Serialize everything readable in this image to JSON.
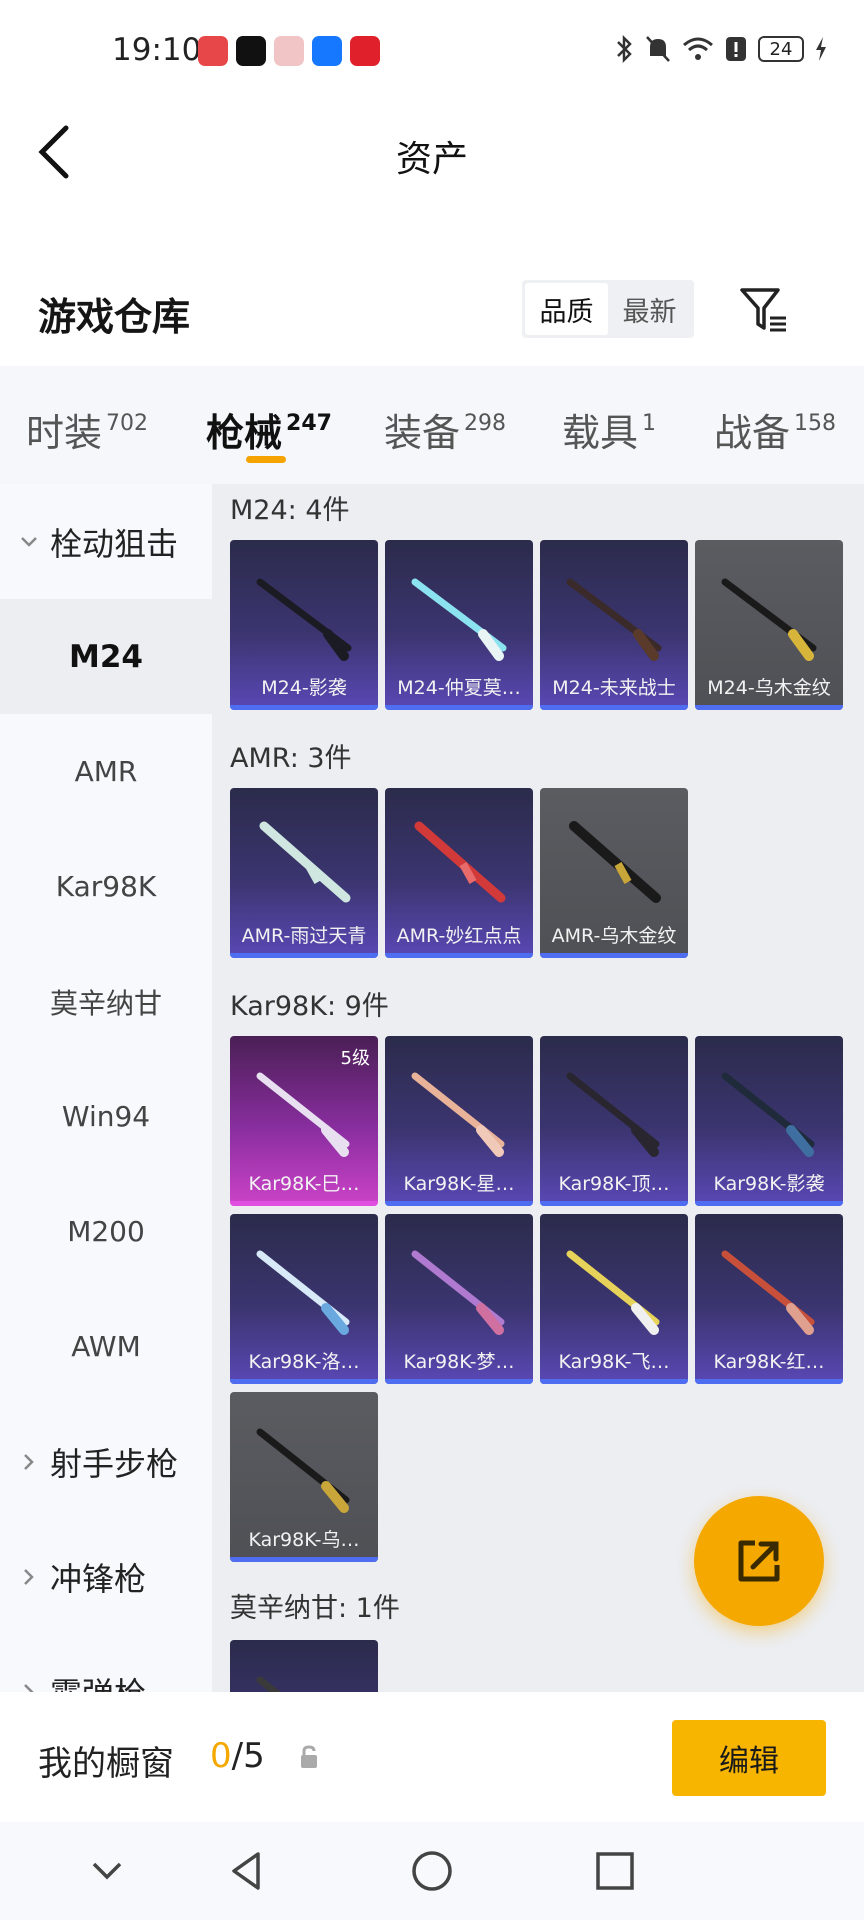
{
  "status_bar": {
    "time": "19:10",
    "battery": "24"
  },
  "header": {
    "title": "资产"
  },
  "warehouse": {
    "title": "游戏仓库",
    "sort_options": [
      "品质",
      "最新"
    ]
  },
  "tabs": [
    {
      "label": "时装",
      "count": "702"
    },
    {
      "label": "枪械",
      "count": "247"
    },
    {
      "label": "装备",
      "count": "298"
    },
    {
      "label": "载具",
      "count": "1"
    },
    {
      "label": "战备",
      "count": "158"
    }
  ],
  "side": {
    "category_open": "栓动狙击",
    "items": [
      "M24",
      "AMR",
      "Kar98K",
      "莫辛纳甘",
      "Win94",
      "M200",
      "AWM"
    ],
    "category_2": "射手步枪",
    "category_3": "冲锋枪",
    "category_4": "霰弹枪"
  },
  "sections": {
    "m24": {
      "title": "M24: 4件",
      "items": [
        "M24-影袭",
        "M24-仲夏莫…",
        "M24-未来战士",
        "M24-乌木金纹"
      ]
    },
    "amr": {
      "title": "AMR: 3件",
      "items": [
        "AMR-雨过天青",
        "AMR-妙红点点",
        "AMR-乌木金纹"
      ]
    },
    "kar": {
      "title": "Kar98K: 9件",
      "level": "5级",
      "items": [
        "Kar98K-巳…",
        "Kar98K-星…",
        "Kar98K-顶…",
        "Kar98K-影袭",
        "Kar98K-洛…",
        "Kar98K-梦…",
        "Kar98K-飞…",
        "Kar98K-红…",
        "Kar98K-乌…"
      ]
    },
    "mosin": {
      "title": "莫辛纳甘: 1件"
    }
  },
  "showcase": {
    "label": "我的橱窗",
    "current": "0",
    "total": "/5",
    "edit_label": "编辑"
  },
  "colors": {
    "accent": "#f5a800",
    "card_purple": "#3b3570",
    "card_gray": "#5b5c61",
    "card_pink": "#cc43c8",
    "card_bar": "#4f6df0"
  }
}
